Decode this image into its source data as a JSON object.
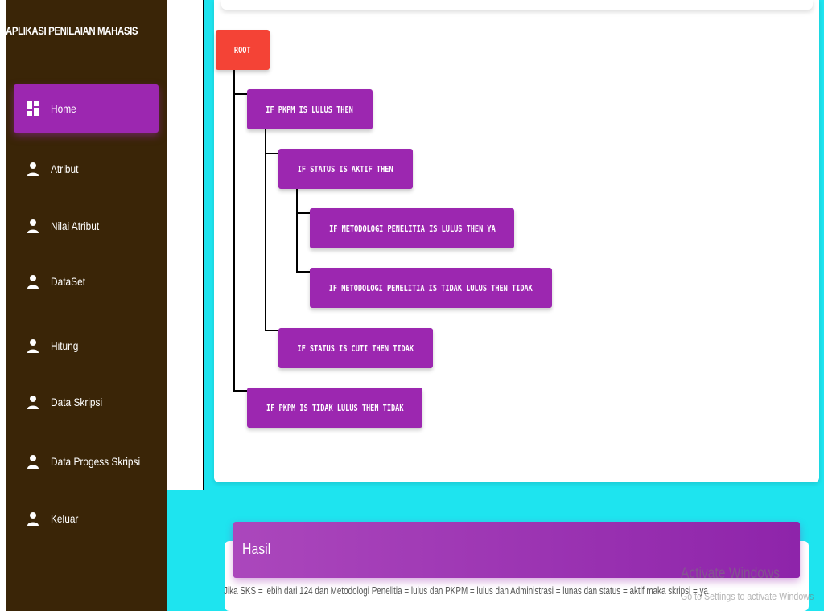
{
  "app_title": "APLIKASI PENILAIAN MAHASISWA S",
  "sidebar": {
    "items": [
      {
        "label": "Home",
        "icon": "dashboard-icon",
        "active": true
      },
      {
        "label": "Atribut",
        "icon": "person-icon"
      },
      {
        "label": "Nilai Atribut",
        "icon": "person-icon"
      },
      {
        "label": "DataSet",
        "icon": "person-icon"
      },
      {
        "label": "Hitung",
        "icon": "person-icon"
      },
      {
        "label": "Data Skripsi",
        "icon": "person-icon"
      },
      {
        "label": "Data Progess Skripsi",
        "icon": "person-icon"
      },
      {
        "label": "Keluar",
        "icon": "person-icon"
      }
    ]
  },
  "tree": {
    "root": "ROOT",
    "nodes": [
      "IF PKPM IS LULUS THEN",
      "IF STATUS IS AKTIF THEN",
      "IF METODOLOGI PENELITIA IS LULUS THEN YA",
      "IF METODOLOGI PENELITIA IS TIDAK LULUS THEN TIDAK",
      "IF STATUS IS CUTI THEN TIDAK",
      "IF PKPM IS TIDAK LULUS THEN TIDAK"
    ]
  },
  "result": {
    "title": "Hasil",
    "text": "Jika SKS = lebih dari 124 dan Metodologi Penelitia = lulus dan PKPM = lulus dan Administrasi = lunas dan status = aktif maka skripsi = ya"
  },
  "watermark": {
    "line1": "Activate Windows",
    "line2": "Go to Settings to activate Windows"
  },
  "colors": {
    "sidebar": "#3a2507",
    "accent": "#9c27b0",
    "root": "#f44336",
    "background": "#1ee4ef"
  }
}
